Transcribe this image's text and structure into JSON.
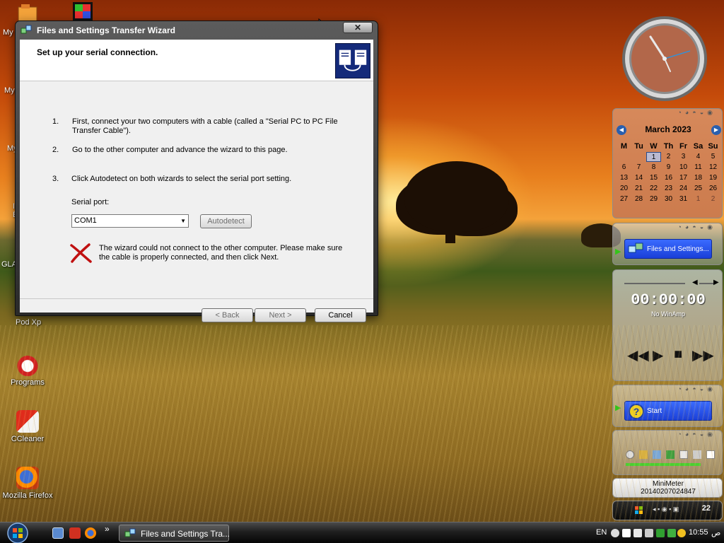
{
  "wizard": {
    "title": "Files and Settings Transfer Wizard",
    "close_label": "✕",
    "header_title": "Set up your serial connection.",
    "steps": [
      {
        "num": "1.",
        "text": "First, connect your two computers with a cable (called a \"Serial PC to PC File Transfer Cable\")."
      },
      {
        "num": "2.",
        "text": "Go to the other computer and advance the wizard to this page."
      },
      {
        "num": "3.",
        "text": "Click Autodetect on both wizards to select the serial port setting."
      }
    ],
    "serial_port_label": "Serial port:",
    "serial_port_value": "COM1",
    "autodetect_label": "Autodetect",
    "error_text": "The wizard could not connect to the other computer. Please make sure the cable is properly connected, and then click Next.",
    "back_label": "< Back",
    "next_label": "Next >",
    "cancel_label": "Cancel"
  },
  "desktop_icons": [
    {
      "label": "Programs",
      "icon": "programs-icon"
    },
    {
      "label": "CCleaner",
      "icon": "ccleaner-icon"
    },
    {
      "label": "Mozilla Firefox",
      "icon": "firefox-icon"
    }
  ],
  "partial_labels": {
    "a": "My I",
    "b": "My",
    "c": "My",
    "d": "I",
    "e": "E",
    "f": "GLA",
    "g": "Pod Xp"
  },
  "calendar": {
    "month": "March 2023",
    "weekdays": [
      "M",
      "Tu",
      "W",
      "Th",
      "Fr",
      "Sa",
      "Su"
    ],
    "days": [
      "",
      "",
      "1",
      "2",
      "3",
      "4",
      "5",
      "6",
      "7",
      "8",
      "9",
      "10",
      "11",
      "12",
      "13",
      "14",
      "15",
      "16",
      "17",
      "18",
      "19",
      "20",
      "21",
      "22",
      "23",
      "24",
      "25",
      "26",
      "27",
      "28",
      "29",
      "30",
      "31",
      "1",
      "2"
    ],
    "today": "1"
  },
  "gadgets": {
    "transfer_shortcut": "Files and Settings...",
    "player_time": "00:00:00",
    "player_status": "No WinAmp",
    "start_shortcut": "Start",
    "minimeter_title": "MiniMeter",
    "minimeter_value": "20140207024847",
    "tray_count": "22"
  },
  "taskbar": {
    "task_label": "Files and Settings Tra...",
    "lang": "EN",
    "time": "10:55",
    "ampm": "ص",
    "overflow": "»"
  },
  "colors": {
    "wizard_frame": "#2a2a2a",
    "dialog_bg": "#f0f0f0",
    "calendar_bg": "#d78c5f",
    "shortcut_blue": "#1a3fd8"
  }
}
